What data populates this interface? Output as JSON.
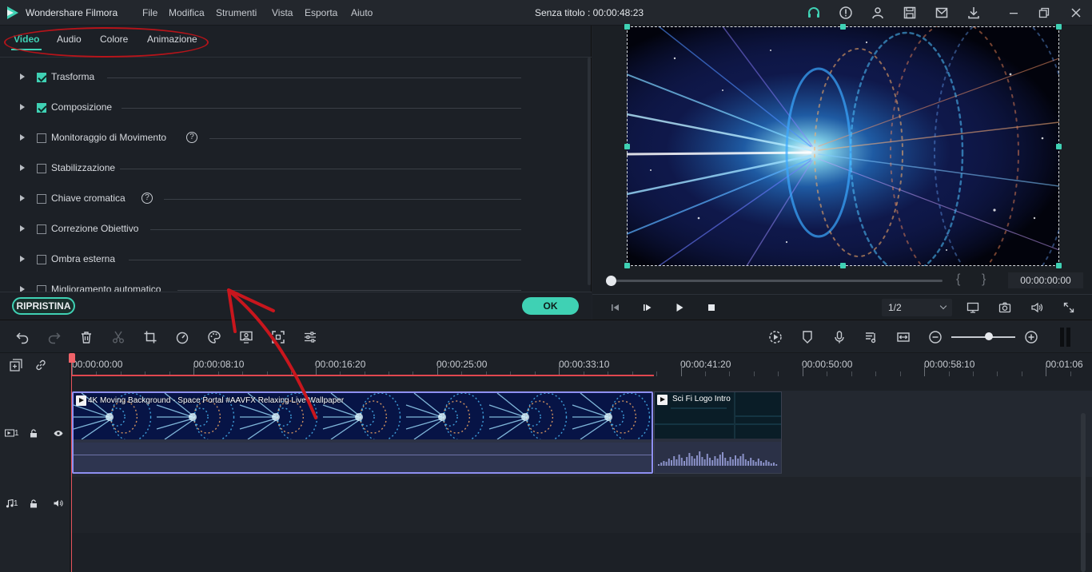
{
  "app": {
    "name": "Wondershare Filmora",
    "doc_title": "Senza titolo : 00:00:48:23"
  },
  "menu": [
    "File",
    "Modifica",
    "Strumenti",
    "Vista",
    "Esporta",
    "Aiuto"
  ],
  "tabs": [
    "Video",
    "Audio",
    "Colore",
    "Animazione"
  ],
  "properties": [
    {
      "label": "Trasforma",
      "checked": true
    },
    {
      "label": "Composizione",
      "checked": true
    },
    {
      "label": "Monitoraggio di Movimento",
      "checked": false
    },
    {
      "label": "Stabilizzazione",
      "checked": false
    },
    {
      "label": "Chiave cromatica",
      "checked": false
    },
    {
      "label": "Correzione Obiettivo",
      "checked": false
    },
    {
      "label": "Ombra esterna",
      "checked": false
    },
    {
      "label": "Miglioramento automatico",
      "checked": false
    }
  ],
  "footer": {
    "reset_label": "RIPRISTINA",
    "ok_label": "OK"
  },
  "preview": {
    "braces": [
      "{",
      "}"
    ],
    "timecode": "00:00:00:00",
    "ratio": "1/2"
  },
  "ruler": [
    "00:00:00:00",
    "00:00:08:10",
    "00:00:16:20",
    "00:00:25:00",
    "00:00:33:10",
    "00:00:41:20",
    "00:00:50:00",
    "00:00:58:10",
    "00:01:06"
  ],
  "tracks": {
    "video_label": "1",
    "audio_label": "1"
  },
  "clips": [
    {
      "title": "4K Moving Background - Space Portal #AAVFX Relaxing Live Wallpaper"
    },
    {
      "title": "Sci Fi Logo Intro"
    }
  ],
  "colors": {
    "accent": "#3fd1b4",
    "playhead": "#e5535a",
    "annotation": "#b5141a",
    "clip_border": "#8e8ff0"
  },
  "icons": [
    "filmora-logo-icon",
    "headset-icon",
    "info-icon",
    "user-icon",
    "save-icon",
    "mail-icon",
    "download-icon",
    "minimize-icon",
    "restore-icon",
    "close-icon",
    "undo-icon",
    "redo-icon",
    "delete-icon",
    "scissors-icon",
    "crop-icon",
    "speed-icon",
    "color-palette-icon",
    "green-screen-icon",
    "fullscreen-frame-icon",
    "adjust-icon",
    "render-icon",
    "marker-icon",
    "microphone-icon",
    "audio-mixer-icon",
    "fit-icon",
    "zoom-out-icon",
    "zoom-in-icon",
    "add-track-icon",
    "link-icon",
    "lock-icon",
    "eye-icon",
    "speaker-icon",
    "prev-frame-icon",
    "play-from-icon",
    "play-icon",
    "stop-icon",
    "display-icon",
    "snapshot-icon",
    "volume-icon",
    "expand-icon"
  ]
}
